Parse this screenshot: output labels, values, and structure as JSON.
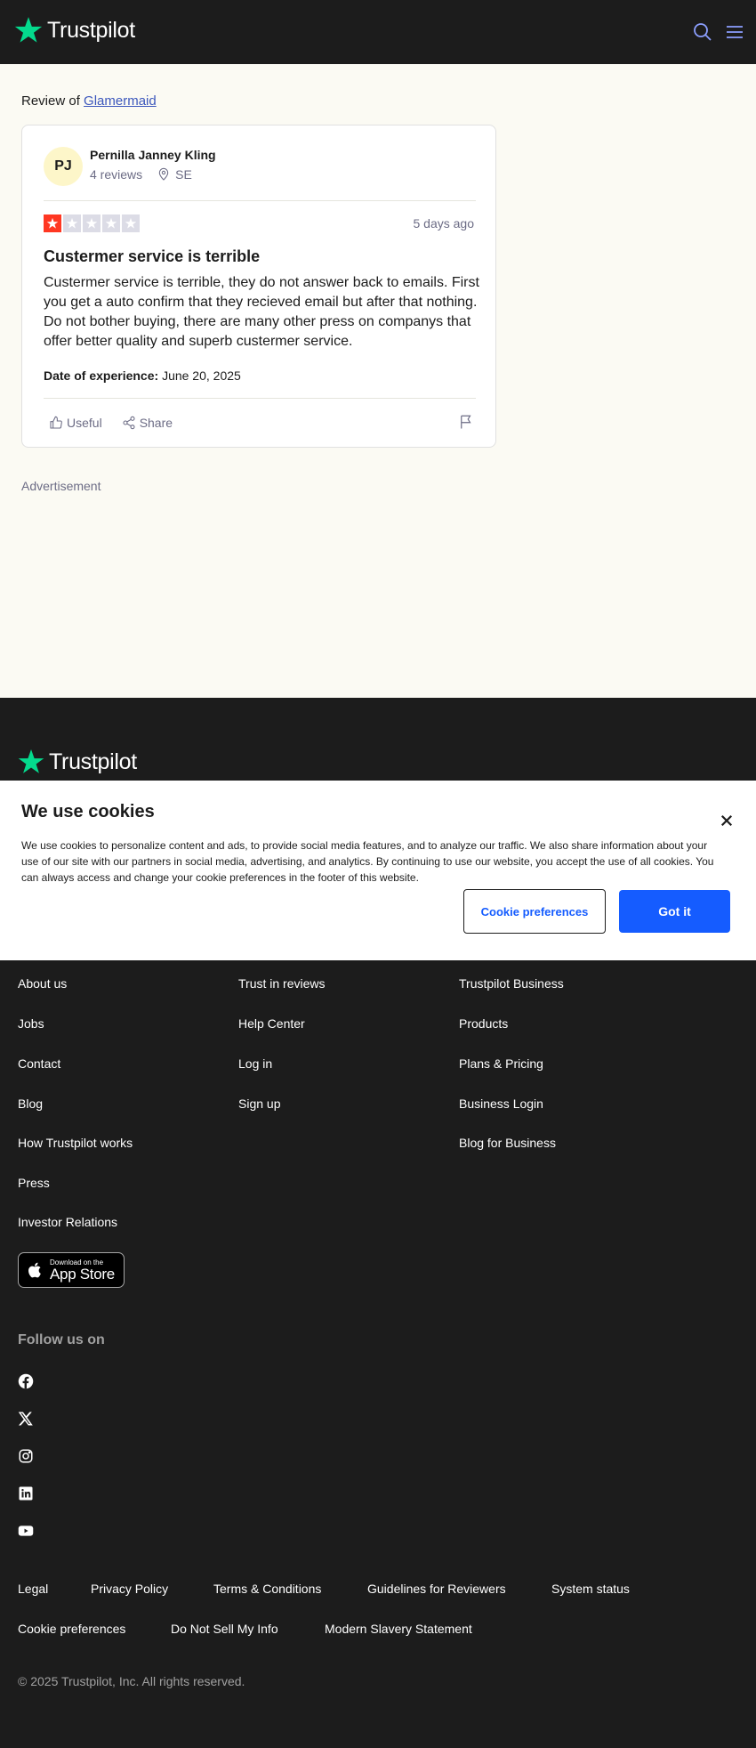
{
  "header": {
    "logo_text": "Trustpilot",
    "logo_icon": "star-icon",
    "search_icon": "search-icon",
    "menu_icon": "menu-icon"
  },
  "review": {
    "review_of_prefix": "Review of",
    "company": "Glamermaid",
    "reviewer": {
      "initials": "PJ",
      "name": "Pernilla Janney Kling",
      "reviews_count": "4 reviews",
      "country": "SE"
    },
    "rating": 1,
    "rating_max": 5,
    "date": "5 days ago",
    "title": "Custermer service is terrible",
    "body": "Custermer service is terrible, they do not answer back to emails. First you get a auto confirm that they recieved email but after that nothing. Do not bother buying, there are many other press on companys that offer better quality and superb custermer service.",
    "experience_label": "Date of experience:",
    "experience_date": "June 20, 2025",
    "useful_label": "Useful",
    "share_label": "Share"
  },
  "advertisement_label": "Advertisement",
  "footer": {
    "logo_text": "Trustpilot",
    "col1": [
      "About us",
      "Jobs",
      "Contact",
      "Blog",
      "How Trustpilot works",
      "Press",
      "Investor Relations"
    ],
    "col2": [
      "Trust in reviews",
      "Help Center",
      "Log in",
      "Sign up"
    ],
    "col3": [
      "Trustpilot Business",
      "Products",
      "Plans & Pricing",
      "Business Login",
      "Blog for Business"
    ],
    "app_store_small": "Download on the",
    "app_store_big": "App Store",
    "follow_label": "Follow us on",
    "social": [
      "facebook-icon",
      "x-icon",
      "instagram-icon",
      "linkedin-icon",
      "youtube-icon"
    ],
    "legal_row1": [
      "Legal",
      "Privacy Policy",
      "Terms & Conditions",
      "Guidelines for Reviewers",
      "System status"
    ],
    "legal_row2": [
      "Cookie preferences",
      "Do Not Sell My Info",
      "Modern Slavery Statement"
    ],
    "copyright": "© 2025 Trustpilot, Inc. All rights reserved."
  },
  "cookie": {
    "title": "We use cookies",
    "text": "We use cookies to personalize content and ads, to provide social media features, and to analyze our traffic. We also share information about your use of our site with our partners in social media, advertising, and analytics. By continuing to use our website, you accept the use of all cookies. You can always access and change your cookie preferences in the footer of this website.",
    "preferences_button": "Cookie preferences",
    "accept_button": "Got it"
  },
  "colors": {
    "brand_green": "#04da8d",
    "star_red": "#ff3722",
    "primary_blue": "#155cff",
    "link_blue": "#3c57bc"
  }
}
